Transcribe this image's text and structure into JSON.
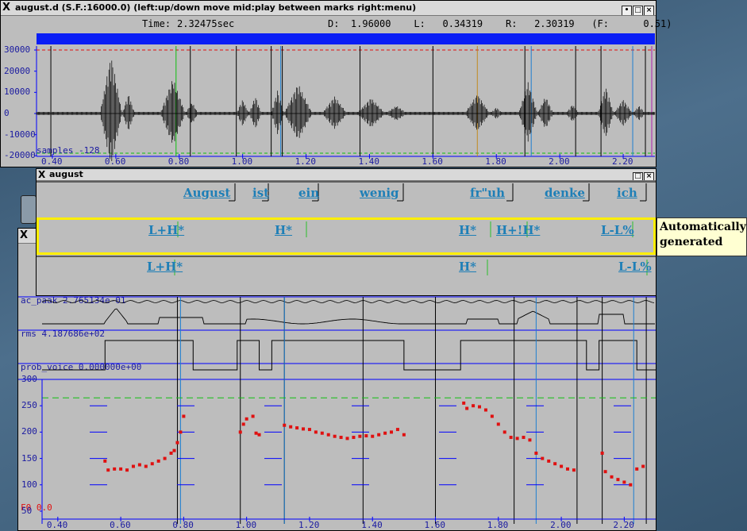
{
  "colors": {
    "desktop": "#3c5a72",
    "win_bg": "#bdbdbd",
    "blue": "#0000ff",
    "red": "#e01010",
    "green": "#10c010",
    "label_blue": "#1e7fb7",
    "highlight": "#ffee00"
  },
  "waveform_window": {
    "logo": "X",
    "title": "august.d (S.F.:16000.0) (left:up/down move  mid:play between marks  right:menu)",
    "time_label": "Time:",
    "time_value": "2.32475sec",
    "readout": "D:  1.96000    L:   0.34319    R:   2.30319   (F:      0.51)",
    "y_ticks": [
      "30000",
      "20000",
      "10000",
      "0",
      "-10000",
      "-20000"
    ],
    "samples_label": "samples  -128",
    "x_ticks": [
      "0.40",
      "0.60",
      "0.80",
      "1.00",
      "1.20",
      "1.40",
      "1.60",
      "1.80",
      "2.00",
      "2.20"
    ]
  },
  "label_window": {
    "logo": "X",
    "title": "august",
    "words": [
      "August",
      "ist",
      "ein",
      "wenig",
      "fr\"uh",
      "denke",
      "ich"
    ],
    "auto_tones": [
      "L+H*",
      "H*",
      "H*",
      "H+!H*",
      "L-L%"
    ],
    "manual_tones": [
      "L+H*",
      "H*",
      "L-L%"
    ]
  },
  "callout": {
    "line1": "Automatically",
    "line2": "generated"
  },
  "f0_window": {
    "logo": "X",
    "ac_peak": "ac_paak  2.765134e-01",
    "rms": "rms 4.187686e+02",
    "prob_voice": "prob_voice 0.000000e+00",
    "y_ticks": [
      "300",
      "250",
      "200",
      "150",
      "100",
      "50"
    ],
    "f0_label": "F0   0.0",
    "x_ticks": [
      "0.40",
      "0.60",
      "0.80",
      "1.00",
      "1.20",
      "1.40",
      "1.60",
      "1.80",
      "2.00",
      "2.20"
    ]
  },
  "chart_data": [
    {
      "type": "line",
      "title": "",
      "ylabel": "",
      "xlim": [
        0.35,
        2.3
      ],
      "ylim": [
        -30000,
        30000
      ],
      "series": [
        {
          "values_note": "",
          "x": [],
          "y": []
        }
      ]
    },
    {
      "type": "scatter",
      "title": "",
      "xlim": [
        0.35,
        2.3
      ],
      "ylim": [
        50,
        300
      ],
      "series": [
        {
          "name": "F0",
          "x": [
            0.55,
            0.56,
            0.58,
            0.6,
            0.62,
            0.64,
            0.66,
            0.68,
            0.7,
            0.72,
            0.74,
            0.76,
            0.77,
            0.78,
            0.79,
            0.8,
            0.98,
            0.99,
            1.0,
            1.02,
            1.03,
            1.04,
            1.12,
            1.14,
            1.16,
            1.18,
            1.2,
            1.22,
            1.24,
            1.26,
            1.28,
            1.3,
            1.32,
            1.34,
            1.36,
            1.38,
            1.4,
            1.42,
            1.44,
            1.46,
            1.48,
            1.5,
            1.69,
            1.7,
            1.72,
            1.74,
            1.76,
            1.78,
            1.8,
            1.82,
            1.84,
            1.86,
            1.88,
            1.9,
            1.92,
            1.94,
            1.96,
            1.98,
            2.0,
            2.02,
            2.04,
            2.13,
            2.14,
            2.16,
            2.18,
            2.2,
            2.22,
            2.24,
            2.26
          ],
          "y": [
            145,
            128,
            130,
            130,
            128,
            135,
            138,
            135,
            140,
            145,
            150,
            160,
            165,
            180,
            200,
            230,
            200,
            215,
            225,
            230,
            198,
            195,
            213,
            210,
            208,
            206,
            205,
            200,
            198,
            195,
            192,
            190,
            188,
            190,
            192,
            193,
            192,
            195,
            198,
            200,
            205,
            195,
            255,
            245,
            250,
            248,
            242,
            230,
            215,
            200,
            190,
            188,
            190,
            185,
            160,
            150,
            145,
            140,
            135,
            130,
            128,
            160,
            125,
            115,
            110,
            105,
            100,
            130,
            135
          ]
        }
      ]
    }
  ]
}
